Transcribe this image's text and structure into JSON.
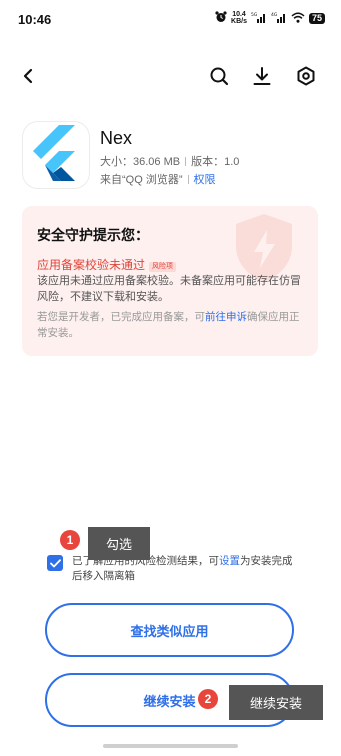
{
  "status_bar": {
    "time": "10:46",
    "speed_value": "10.4",
    "speed_unit": "KB/s",
    "battery": "75",
    "icons": [
      "alarm-icon",
      "signal-5g-icon",
      "signal-4g-icon",
      "wifi-icon",
      "battery-icon"
    ]
  },
  "nav": {
    "icons": [
      "back-arrow-icon",
      "search-icon",
      "download-icon",
      "settings-hex-icon"
    ]
  },
  "app": {
    "name": "Nex",
    "size": "大小：36.06 MB",
    "version": "版本：1.0",
    "source": "来自“QQ 浏览器”",
    "permissions": "权限",
    "icon": "flutter-logo-icon"
  },
  "security": {
    "title": "安全守护提示您：",
    "warning": "应用备案校验未通过",
    "risk_badge": "风险项",
    "description": "该应用未通过应用备案校验。未备案应用可能存在仿冒风险，不建议下载和安装。",
    "dev_prefix": "若您是开发者，已完成应用备案，可",
    "dev_link": "前往申诉",
    "dev_suffix": "确保应用正常安装。",
    "accent_color": "#e0453a"
  },
  "consent": {
    "prefix": "已了解应用的风险检测结果，可",
    "settings_link": "设置",
    "suffix": "为安装完成后移入隔离箱",
    "checked": true
  },
  "buttons": {
    "find_similar": "查找类似应用",
    "continue_install": "继续安装"
  },
  "annotations": {
    "marker_1": "1",
    "tip_1": "勾选",
    "marker_2": "2",
    "tip_2": "继续安装"
  },
  "colors": {
    "accent": "#2f6fe8",
    "warning": "#e0453a",
    "card_bg": "#fdf0ef"
  }
}
